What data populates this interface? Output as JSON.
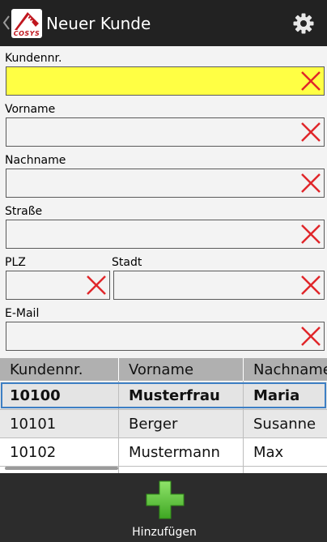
{
  "app_bar": {
    "title": "Neuer Kunde",
    "logo_text": "COSYS",
    "back_icon": "chevron-left-icon",
    "settings_icon": "gear-icon"
  },
  "form": {
    "kundennr": {
      "label": "Kundennr.",
      "value": ""
    },
    "vorname": {
      "label": "Vorname",
      "value": ""
    },
    "nachname": {
      "label": "Nachname",
      "value": ""
    },
    "strasse": {
      "label": "Straße",
      "value": ""
    },
    "plz": {
      "label": "PLZ",
      "value": ""
    },
    "stadt": {
      "label": "Stadt",
      "value": ""
    },
    "email": {
      "label": "E-Mail",
      "value": ""
    },
    "clear_icon": "clear-x-icon",
    "active_field_color": "#ffff44",
    "clear_icon_color": "#e0262a"
  },
  "table": {
    "columns": [
      "Kundennr.",
      "Vorname",
      "Nachname"
    ],
    "rows": [
      {
        "kundennr": "10100",
        "vorname": "Musterfrau",
        "nachname": "Maria",
        "selected": true
      },
      {
        "kundennr": "10101",
        "vorname": "Berger",
        "nachname": "Susanne",
        "selected": false
      },
      {
        "kundennr": "10102",
        "vorname": "Mustermann",
        "nachname": "Max",
        "selected": false
      }
    ],
    "selection_color": "#3d7fc4"
  },
  "bottom_bar": {
    "add_label": "Hinzufügen",
    "add_icon": "plus-icon",
    "add_icon_color": "#5fc93a"
  }
}
